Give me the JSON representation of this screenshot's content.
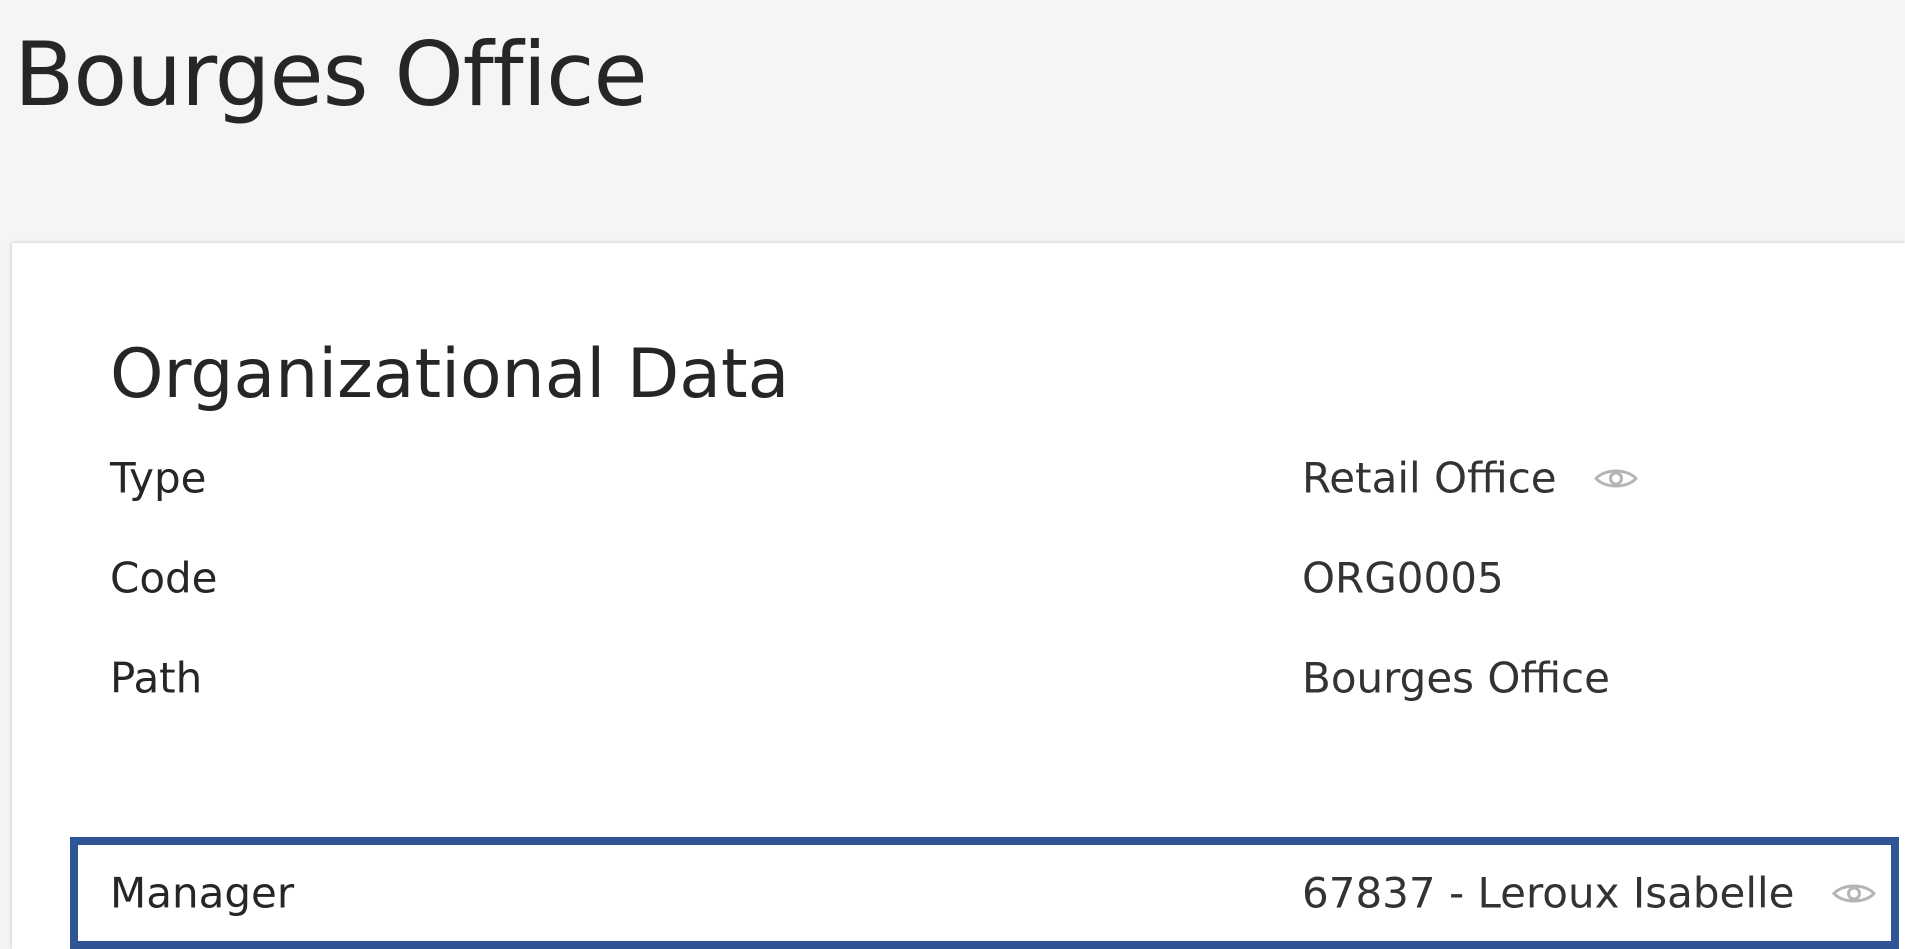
{
  "page": {
    "title": "Bourges Office"
  },
  "section": {
    "title": "Organizational Data",
    "fields": [
      {
        "label": "Type",
        "value": "Retail Office",
        "icon": "eye-icon"
      },
      {
        "label": "Code",
        "value": "ORG0005"
      },
      {
        "label": "Path",
        "value": "Bourges Office"
      },
      {
        "label": "Manager",
        "value": "67837 - Leroux Isabelle",
        "icon": "eye-icon",
        "selected": true
      }
    ]
  },
  "colors": {
    "background": "#f5f5f5",
    "card": "#ffffff",
    "selection_border": "#2f5597",
    "icon": "#b5b5b5"
  }
}
